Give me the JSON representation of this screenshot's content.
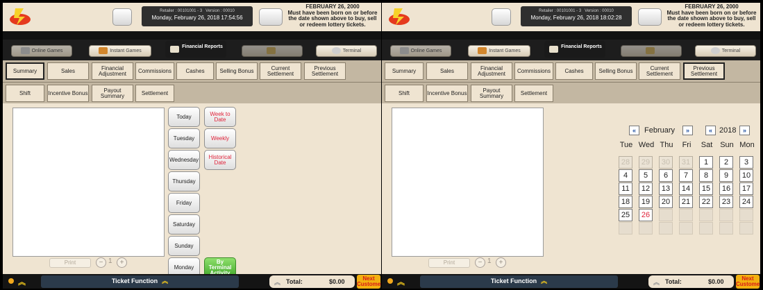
{
  "screens": [
    {
      "retailer": "Retailer : 00101001 - 3",
      "version": "Version : 00010",
      "datetime": "Monday, February 26, 2018 17:54:56",
      "notice_date": "FEBRUARY 26, 2000",
      "notice_text": "Must have been born on or before the date shown above to buy, sell or redeem lottery tickets.",
      "main_tabs": [
        "Online Games",
        "Instant Games",
        "Financial Reports",
        "",
        "Terminal"
      ],
      "subtabs_row1": [
        "Summary",
        "Sales",
        "Financial Adjustment",
        "Commissions",
        "Cashes",
        "Selling Bonus",
        "Current Settlement",
        "Previous Settlement"
      ],
      "subtabs_row2": [
        "Shift",
        "Incentive Bonus",
        "Payout Summary",
        "Settlement"
      ],
      "print_label": "Print",
      "page_number": "1",
      "ticket_function": "Ticket Function",
      "total_label": "Total:",
      "total_value": "$0.00",
      "next_customer": "Next Customer"
    },
    {
      "retailer": "Retailer : 00101001 - 3",
      "version": "Version : 00010",
      "datetime": "Monday, February 26, 2018 18:02:28",
      "notice_date": "FEBRUARY 26, 2000",
      "notice_text": "Must have been born on or before the date shown above to buy, sell or redeem lottery tickets.",
      "main_tabs": [
        "Online Games",
        "Instant Games",
        "Financial Reports",
        "",
        "Terminal"
      ],
      "subtabs_row1": [
        "Summary",
        "Sales",
        "Financial Adjustment",
        "Commissions",
        "Cashes",
        "Selling Bonus",
        "Current Settlement",
        "Previous Settlement"
      ],
      "subtabs_row2": [
        "Shift",
        "Incentive Bonus",
        "Payout Summary",
        "Settlement"
      ],
      "print_label": "Print",
      "page_number": "1",
      "ticket_function": "Ticket Function",
      "total_label": "Total:",
      "total_value": "$0.00",
      "next_customer": "Next Customer"
    }
  ],
  "date_buttons": {
    "today": "Today",
    "tuesday": "Tuesday",
    "wednesday": "Wednesday",
    "thursday": "Thursday",
    "friday": "Friday",
    "saturday": "Saturday",
    "sunday": "Sunday",
    "monday": "Monday",
    "week_to_date": "Week to Date",
    "weekly": "Weekly",
    "historical_date": "Historical Date",
    "by_terminal": "By Terminal Activity"
  },
  "calendar": {
    "month": "February",
    "year": "2018",
    "prev": "«",
    "next": "»",
    "weekdays": [
      "Tue",
      "Wed",
      "Thu",
      "Fri",
      "Sat",
      "Sun",
      "Mon"
    ],
    "days": [
      [
        "28",
        "29",
        "30",
        "31",
        "1",
        "2",
        "3"
      ],
      [
        "4",
        "5",
        "6",
        "7",
        "8",
        "9",
        "10"
      ],
      [
        "11",
        "12",
        "13",
        "14",
        "15",
        "16",
        "17"
      ],
      [
        "18",
        "19",
        "20",
        "21",
        "22",
        "23",
        "24"
      ],
      [
        "25",
        "26",
        "",
        "",
        "",
        "",
        ""
      ],
      [
        "",
        "",
        "",
        "",
        "",
        "",
        ""
      ]
    ],
    "other_month_days": [
      "28",
      "29",
      "30",
      "31"
    ],
    "today": "26"
  },
  "colors": {
    "accent_red": "#e0233a",
    "accent_green": "#42a82a",
    "accent_gold": "#f2b010"
  }
}
